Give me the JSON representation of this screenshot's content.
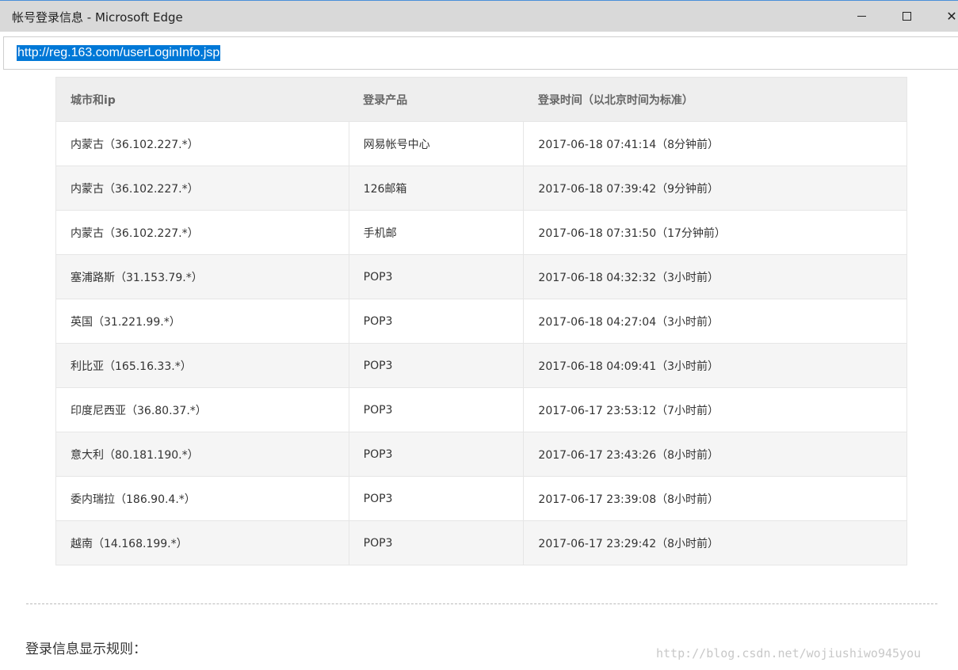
{
  "window": {
    "title": "帐号登录信息 - Microsoft Edge",
    "minimize_label": "",
    "maximize_label": "",
    "close_label": "✕"
  },
  "address_bar": {
    "url": "http://reg.163.com/userLoginInfo.jsp"
  },
  "table": {
    "headers": [
      "城市和ip",
      "登录产品",
      "登录时间（以北京时间为标准）"
    ],
    "rows": [
      [
        "内蒙古（36.102.227.*）",
        "网易帐号中心",
        "2017-06-18 07:41:14（8分钟前）"
      ],
      [
        "内蒙古（36.102.227.*）",
        "126邮箱",
        "2017-06-18 07:39:42（9分钟前）"
      ],
      [
        "内蒙古（36.102.227.*）",
        "手机邮",
        "2017-06-18 07:31:50（17分钟前）"
      ],
      [
        "塞浦路斯（31.153.79.*）",
        "POP3",
        "2017-06-18 04:32:32（3小时前）"
      ],
      [
        "英国（31.221.99.*）",
        "POP3",
        "2017-06-18 04:27:04（3小时前）"
      ],
      [
        "利比亚（165.16.33.*）",
        "POP3",
        "2017-06-18 04:09:41（3小时前）"
      ],
      [
        "印度尼西亚（36.80.37.*）",
        "POP3",
        "2017-06-17 23:53:12（7小时前）"
      ],
      [
        "意大利（80.181.190.*）",
        "POP3",
        "2017-06-17 23:43:26（8小时前）"
      ],
      [
        "委内瑞拉（186.90.4.*）",
        "POP3",
        "2017-06-17 23:39:08（8小时前）"
      ],
      [
        "越南（14.168.199.*）",
        "POP3",
        "2017-06-17 23:29:42（8小时前）"
      ]
    ]
  },
  "rules_title": "登录信息显示规则：",
  "watermark": "http://blog.csdn.net/wojiushiwo945you"
}
